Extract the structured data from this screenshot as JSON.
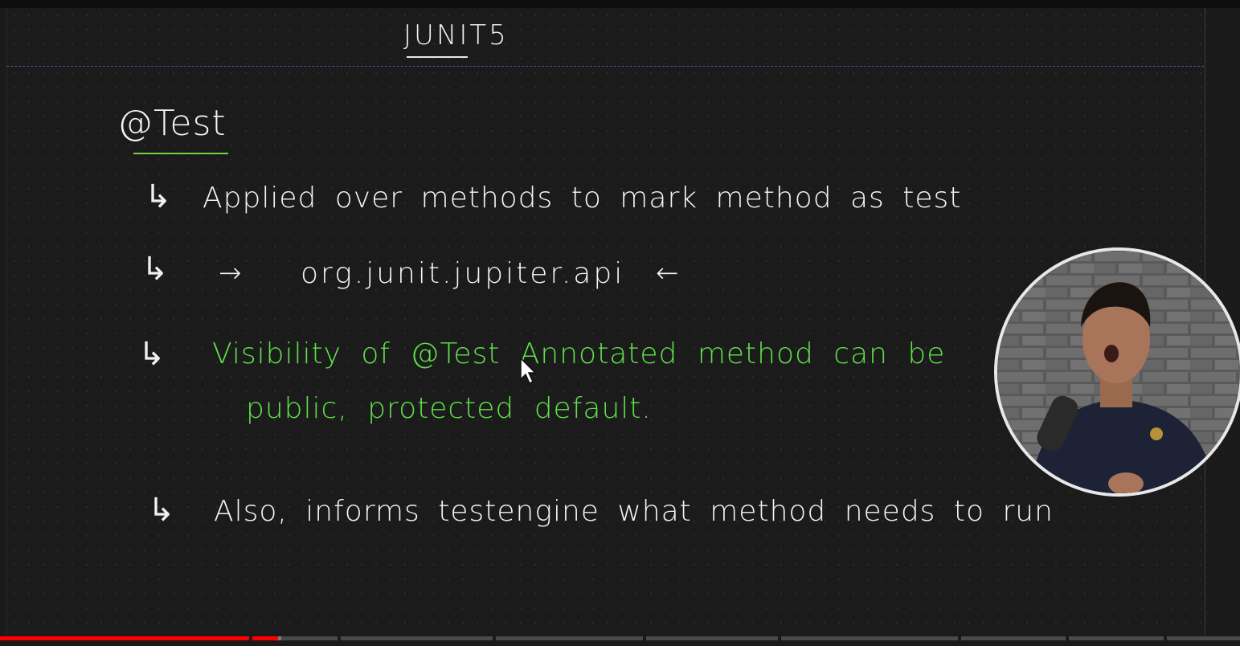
{
  "whiteboard": {
    "title": "JUNIT5",
    "heading": "@Test",
    "bullets": [
      {
        "marker": "↳",
        "text": "Applied over methods to mark method as test"
      },
      {
        "marker": "↳",
        "arrow_left": "→",
        "text": "org.junit.jupiter.api",
        "arrow_right": "←"
      },
      {
        "marker": "↳",
        "text_line1": "Visibility of @Test Annotated method can be",
        "text_line2": "public, protected default."
      },
      {
        "marker": "↳",
        "text": "Also, informs testengine what method needs to run"
      }
    ],
    "colors": {
      "chalk_white": "#f5f5f5",
      "chalk_green": "#5fe04a",
      "board_background": "#1b1b1b",
      "separator_dash": "#3a5c8c"
    }
  },
  "webcam_overlay": {
    "description_icon": "presenter-webcam-icon"
  },
  "player": {
    "progress_fraction": 0.224,
    "buffered_fraction": 0.227,
    "progress_color": "#ff0000"
  }
}
